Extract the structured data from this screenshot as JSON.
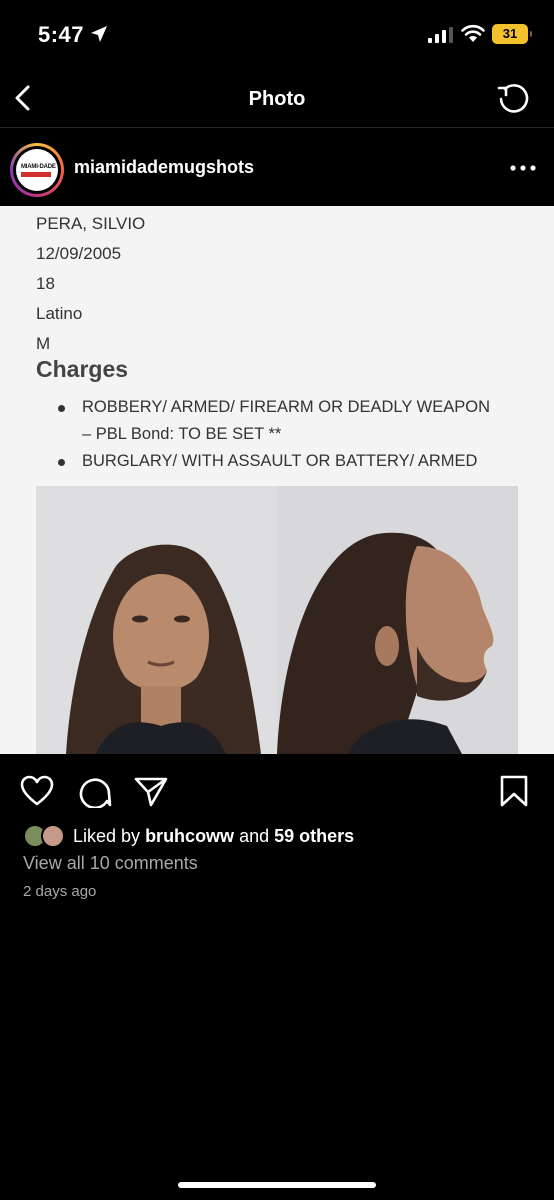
{
  "status_bar": {
    "time": "5:47",
    "battery": "31"
  },
  "nav": {
    "title": "Photo"
  },
  "post": {
    "username": "miamidademugshots",
    "avatar_text": "MIAMI-DADE"
  },
  "photo": {
    "name": "PERA, SILVIO",
    "dob": "12/09/2005",
    "age": "18",
    "ethnicity": "Latino",
    "sex": "M",
    "charges_title": "Charges",
    "charges": [
      {
        "line1": "ROBBERY/ ARMED/ FIREARM OR DEADLY WEAPON",
        "line2": "– PBL Bond: TO BE SET **"
      },
      {
        "line1": "BURGLARY/ WITH ASSAULT OR BATTERY/ ARMED",
        "line2": ""
      }
    ]
  },
  "likes": {
    "prefix": "Liked by",
    "user": "bruhcoww",
    "middle": "and",
    "others": "59 others"
  },
  "comments_link": "View all 10 comments",
  "posted": "2 days ago",
  "colors": {
    "battery": "#f3c12b",
    "muted_text": "#a8a8a8",
    "photo_bg": "#f4f4f4"
  }
}
